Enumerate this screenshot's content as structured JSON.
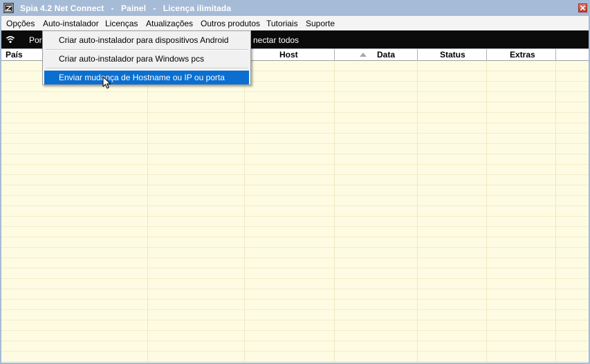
{
  "window": {
    "title": "Spia 4.2 Net Connect   -   Painel   -   Licença ilimitada"
  },
  "menubar": {
    "items": [
      "Opções",
      "Auto-instalador",
      "Licenças",
      "Atualizações",
      "Outros produtos",
      "Tutoriais",
      "Suporte"
    ]
  },
  "toolbar": {
    "left_label": "Por",
    "right_label": "nectar todos"
  },
  "table": {
    "columns": [
      "País",
      "",
      "",
      "Host",
      "Data",
      "Status",
      "Extras",
      ""
    ],
    "sorted_column": "Data",
    "rows": []
  },
  "dropdown": {
    "open_menu": "Auto-instalador",
    "items": [
      "Criar auto-instalador para dispositivos Android",
      "Criar auto-instalador para Windows pcs",
      "Enviar mudança de Hostname ou IP ou porta"
    ],
    "highlighted_index": 2
  },
  "colors": {
    "titlebar": "#a6bbd6",
    "menubar": "#f4f4f4",
    "toolbar": "#0b0b0b",
    "grid_background": "#fdfbe2",
    "highlight": "#0a6fd0",
    "close_button": "#c23c2f"
  },
  "icons": {
    "app": "app-logo-icon",
    "close": "close-icon",
    "connection": "wifi-icon",
    "sort": "sort-ascending-icon",
    "pointer": "mouse-cursor-icon"
  }
}
